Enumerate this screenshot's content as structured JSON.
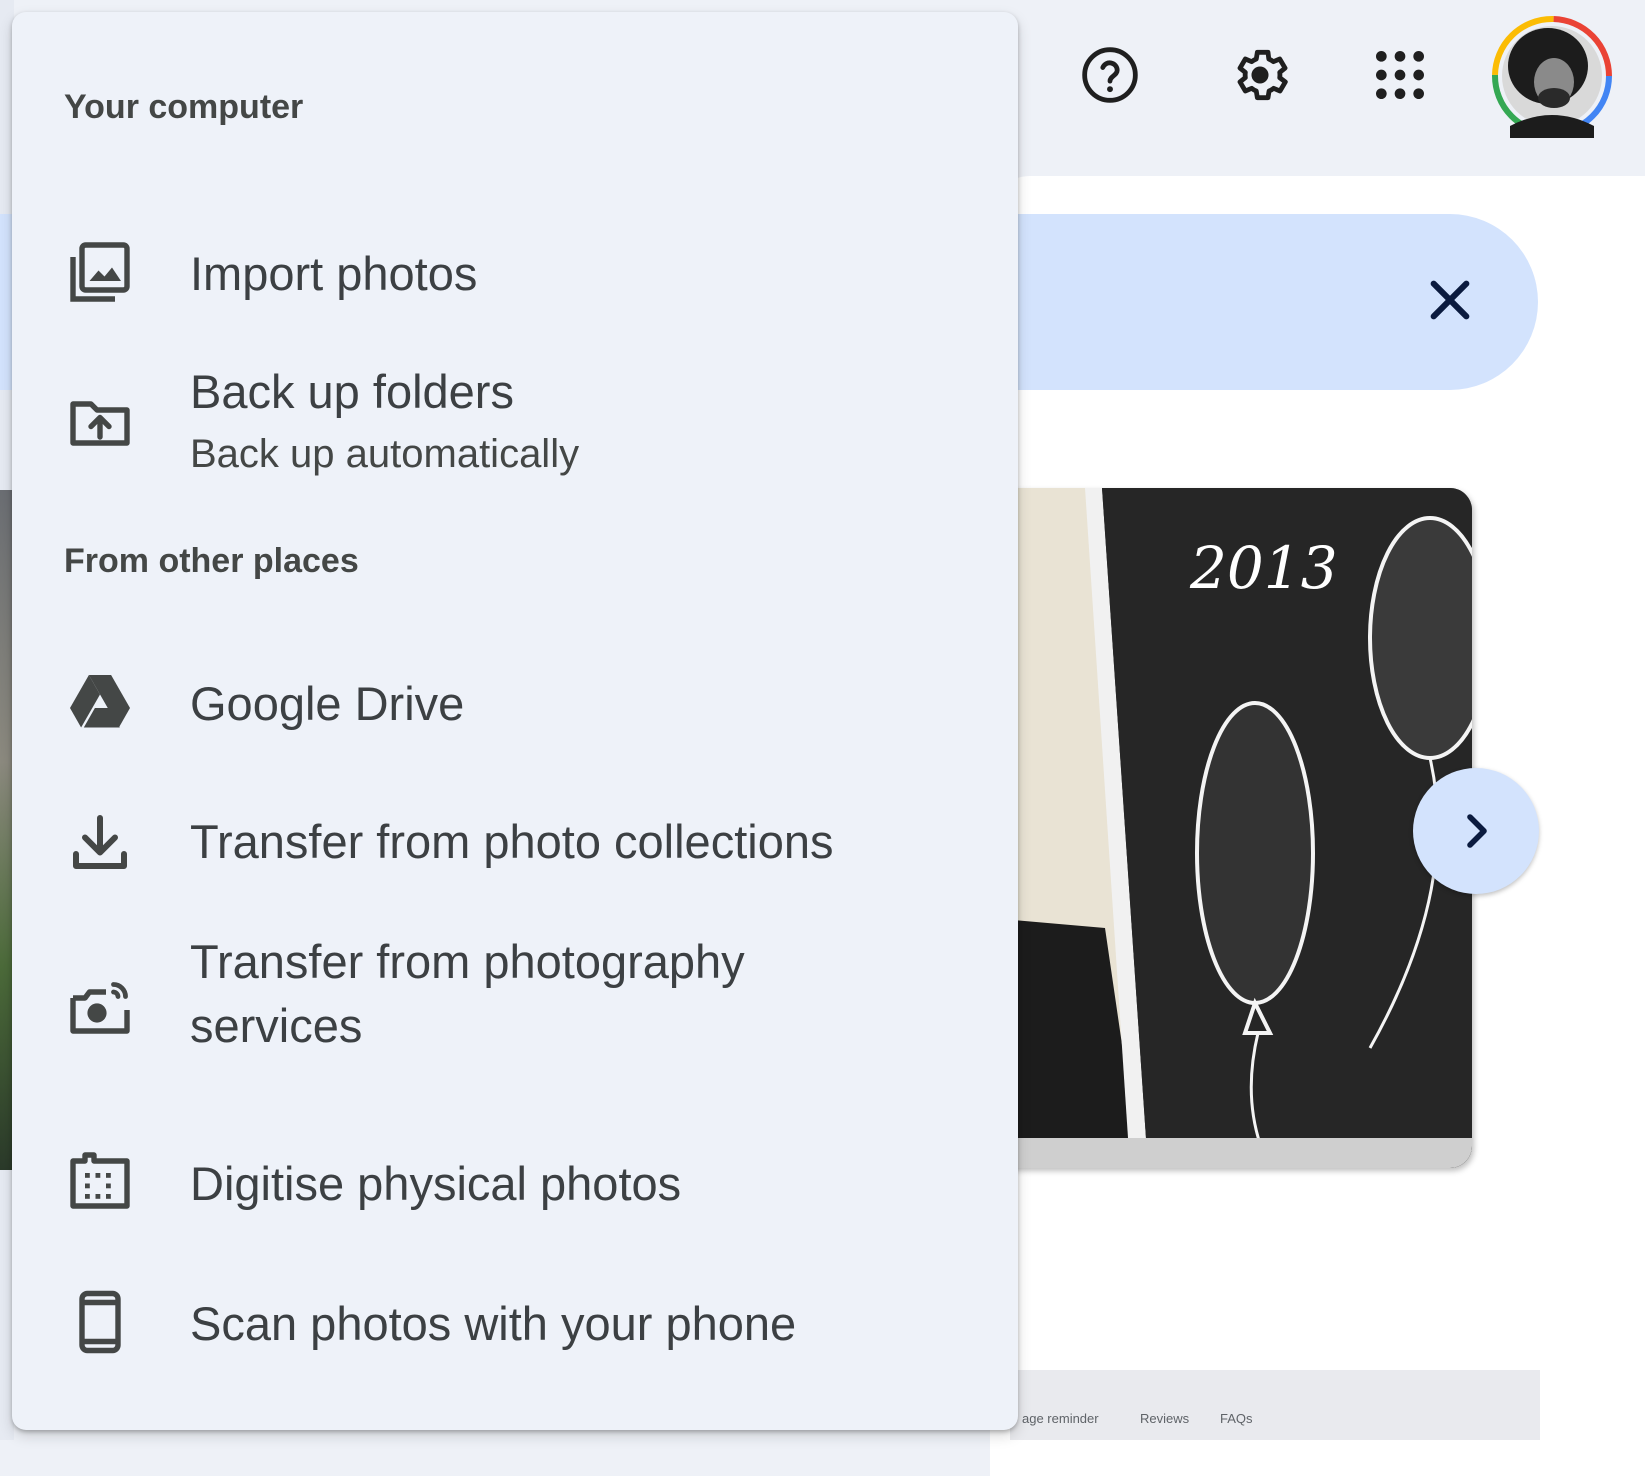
{
  "menu": {
    "your_computer_header": "Your computer",
    "from_other_places_header": "From other places",
    "items": [
      {
        "label": "Import photos",
        "icon": "photo-library-icon"
      },
      {
        "label": "Back up folders",
        "sublabel": "Back up automatically",
        "icon": "folder-upload-icon"
      },
      {
        "label": "Google Drive",
        "icon": "google-drive-icon"
      },
      {
        "label": "Transfer from photo collections",
        "icon": "download-icon"
      },
      {
        "label_line1": "Transfer from photography",
        "label_line2": "services",
        "icon": "camera-sync-icon"
      },
      {
        "label": "Digitise physical photos",
        "icon": "photo-scan-icon"
      },
      {
        "label": "Scan photos with your phone",
        "icon": "smartphone-icon"
      }
    ]
  },
  "topbar": {
    "icons": [
      "help-icon",
      "settings-icon",
      "apps-grid-icon",
      "account-avatar"
    ]
  },
  "memory_card": {
    "handwritten_text": "2013"
  },
  "bottom_thumb": {
    "texts": [
      "age reminder",
      "Reviews",
      "FAQs"
    ]
  },
  "colors": {
    "menu_bg": "#eef2f9",
    "banner_bg": "#d3e3fd",
    "icon_color": "#444746",
    "text_color": "#3c4043"
  }
}
